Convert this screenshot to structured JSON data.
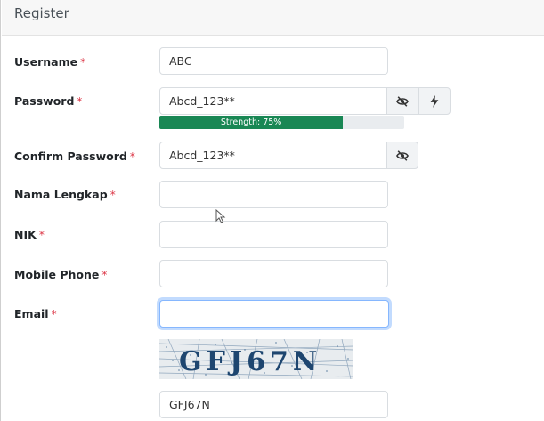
{
  "card": {
    "title": "Register"
  },
  "required_mark": "*",
  "fields": {
    "username": {
      "label": "Username",
      "value": "ABC"
    },
    "password": {
      "label": "Password",
      "value": "Abcd_123**",
      "strength_text": "Strength: 75%",
      "strength_percent": 75
    },
    "confirm_password": {
      "label": "Confirm Password",
      "value": "Abcd_123**"
    },
    "nama_lengkap": {
      "label": "Nama Lengkap",
      "value": ""
    },
    "nik": {
      "label": "NIK",
      "value": ""
    },
    "mobile_phone": {
      "label": "Mobile Phone",
      "value": ""
    },
    "email": {
      "label": "Email",
      "value": ""
    },
    "captcha": {
      "image_text": "GFJ67N",
      "value": "GFJ67N"
    }
  },
  "icons": {
    "password_toggle": "eye-slash-icon",
    "password_generate": "lightning-icon",
    "confirm_toggle": "eye-slash-icon"
  },
  "colors": {
    "required": "#dc3545",
    "strength": "#198754",
    "focus": "#86b7fe",
    "addon_bg": "#f1f3f5"
  }
}
